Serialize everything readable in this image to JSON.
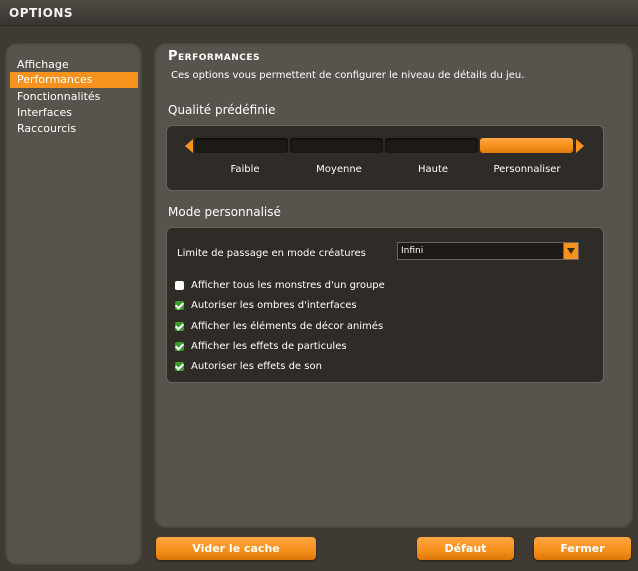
{
  "window": {
    "title": "Options"
  },
  "sidebar": {
    "items": [
      {
        "label": "Affichage"
      },
      {
        "label": "Performances"
      },
      {
        "label": "Fonctionnalités"
      },
      {
        "label": "Interfaces"
      },
      {
        "label": "Raccourcis"
      }
    ],
    "active_index": 1
  },
  "panel": {
    "title": "Performances",
    "description": "Ces options vous permettent de configurer le niveau de détails du jeu.",
    "quality": {
      "title": "Qualité prédéfinie",
      "levels": [
        "Faible",
        "Moyenne",
        "Haute",
        "Personnaliser"
      ],
      "selected_index": 3
    },
    "custom": {
      "title": "Mode personnalisé",
      "creature_limit_label": "Limite de passage en mode créatures",
      "creature_limit_value": "Infini",
      "options": [
        {
          "label": "Afficher tous les monstres d'un groupe",
          "checked": false
        },
        {
          "label": "Autoriser les ombres d'interfaces",
          "checked": true
        },
        {
          "label": "Afficher les éléments de décor animés",
          "checked": true
        },
        {
          "label": "Afficher les effets de particules",
          "checked": true
        },
        {
          "label": "Autoriser les effets de son",
          "checked": true
        }
      ]
    }
  },
  "footer": {
    "clear_cache_label": "Vider le cache",
    "default_label": "Défaut",
    "close_label": "Fermer"
  },
  "colors": {
    "accent": "#f7921e",
    "panel": "#59534d",
    "background": "#3f3a34",
    "inner_box": "#2f2b27",
    "check_on": "#3b9e2a"
  }
}
